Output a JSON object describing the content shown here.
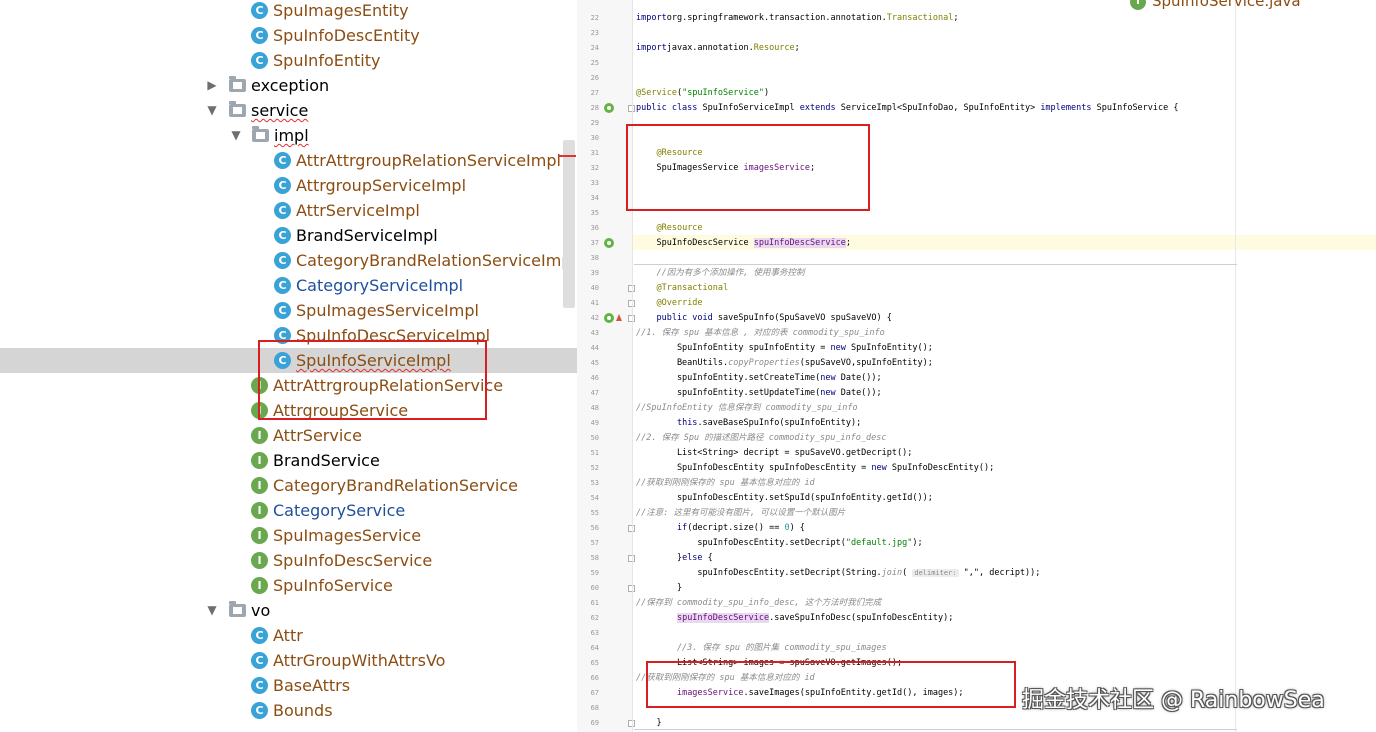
{
  "tree": {
    "rows": [
      {
        "label": "SpuImagesEntity",
        "icon": "class-icon",
        "style": "modified"
      },
      {
        "label": "SpuInfoDescEntity",
        "icon": "class-icon",
        "style": "modified"
      },
      {
        "label": "SpuInfoEntity",
        "icon": "class-icon",
        "style": "modified"
      },
      {
        "label": "exception",
        "icon": "folder-icon",
        "style": "normal",
        "arrow": "▶"
      },
      {
        "label": "service",
        "icon": "folder-icon",
        "style": "normal",
        "arrow": "▼"
      },
      {
        "label": "impl",
        "icon": "folder-icon",
        "style": "normal",
        "arrow": "▼"
      },
      {
        "label": "AttrAttrgroupRelationServiceImpl",
        "icon": "class-icon",
        "style": "modified"
      },
      {
        "label": "AttrgroupServiceImpl",
        "icon": "class-icon",
        "style": "modified"
      },
      {
        "label": "AttrServiceImpl",
        "icon": "class-icon",
        "style": "modified"
      },
      {
        "label": "BrandServiceImpl",
        "icon": "class-icon",
        "style": "normal"
      },
      {
        "label": "CategoryBrandRelationServiceImpl",
        "icon": "class-icon",
        "style": "modified"
      },
      {
        "label": "CategoryServiceImpl",
        "icon": "class-icon",
        "style": "blue"
      },
      {
        "label": "SpuImagesServiceImpl",
        "icon": "class-icon",
        "style": "modified"
      },
      {
        "label": "SpuInfoDescServiceImpl",
        "icon": "class-icon",
        "style": "modified"
      },
      {
        "label": "SpuInfoServiceImpl",
        "icon": "class-icon",
        "style": "modified",
        "selected": true
      },
      {
        "label": "AttrAttrgroupRelationService",
        "icon": "interface-icon",
        "style": "modified"
      },
      {
        "label": "AttrgroupService",
        "icon": "interface-icon",
        "style": "modified"
      },
      {
        "label": "AttrService",
        "icon": "interface-icon",
        "style": "modified"
      },
      {
        "label": "BrandService",
        "icon": "interface-icon",
        "style": "normal"
      },
      {
        "label": "CategoryBrandRelationService",
        "icon": "interface-icon",
        "style": "modified"
      },
      {
        "label": "CategoryService",
        "icon": "interface-icon",
        "style": "blue"
      },
      {
        "label": "SpuImagesService",
        "icon": "interface-icon",
        "style": "modified"
      },
      {
        "label": "SpuInfoDescService",
        "icon": "interface-icon",
        "style": "modified"
      },
      {
        "label": "SpuInfoService",
        "icon": "interface-icon",
        "style": "modified"
      },
      {
        "label": "vo",
        "icon": "folder-icon",
        "style": "normal",
        "arrow": "▼"
      },
      {
        "label": "Attr",
        "icon": "class-icon",
        "style": "modified"
      },
      {
        "label": "AttrGroupWithAttrsVo",
        "icon": "class-icon",
        "style": "modified"
      },
      {
        "label": "BaseAttrs",
        "icon": "class-icon",
        "style": "modified"
      },
      {
        "label": "Bounds",
        "icon": "class-icon",
        "style": "modified"
      }
    ]
  },
  "editor": {
    "tab_title": "SpuInfoService.java",
    "lines": [
      {
        "n": "22",
        "tokens": [
          [
            "kw",
            "import"
          ],
          [
            "",
            "org.springframework.transaction.annotation."
          ],
          [
            "an",
            "Transactional"
          ],
          [
            "",
            ";"
          ]
        ]
      },
      {
        "n": "23",
        "tokens": []
      },
      {
        "n": "24",
        "tokens": [
          [
            "kw",
            "import"
          ],
          [
            "",
            "javax.annotation."
          ],
          [
            "an",
            "Resource"
          ],
          [
            "",
            ";"
          ]
        ]
      },
      {
        "n": "25",
        "tokens": []
      },
      {
        "n": "26",
        "tokens": []
      },
      {
        "n": "27",
        "tokens": [
          [
            "an",
            "@Service"
          ],
          [
            "",
            "("
          ],
          [
            "st",
            "\"spuInfoService\""
          ],
          [
            "",
            ")"
          ]
        ]
      },
      {
        "n": "28",
        "tokens": [
          [
            "kw",
            "public class"
          ],
          [
            "",
            " SpuInfoServiceImpl "
          ],
          [
            "kw",
            "extends"
          ],
          [
            "",
            " ServiceImpl<SpuInfoDao, SpuInfoEntity> "
          ],
          [
            "kw",
            "implements"
          ],
          [
            "",
            " SpuInfoService {"
          ]
        ]
      },
      {
        "n": "29",
        "tokens": []
      },
      {
        "n": "30",
        "tokens": []
      },
      {
        "n": "31",
        "tokens": [
          [
            "",
            "    "
          ],
          [
            "an",
            "@Resource"
          ]
        ]
      },
      {
        "n": "32",
        "tokens": [
          [
            "",
            "    SpuImagesService "
          ],
          [
            "fd",
            "imagesService"
          ],
          [
            "",
            ";"
          ]
        ]
      },
      {
        "n": "33",
        "tokens": []
      },
      {
        "n": "34",
        "tokens": []
      },
      {
        "n": "35",
        "tokens": []
      },
      {
        "n": "36",
        "tokens": [
          [
            "",
            "    "
          ],
          [
            "an",
            "@Resource"
          ]
        ]
      },
      {
        "n": "37",
        "tokens": [
          [
            "",
            "    SpuInfoDescService "
          ],
          [
            "fd hl",
            "spuInfoDescService"
          ],
          [
            "",
            ";"
          ]
        ]
      },
      {
        "n": "38",
        "tokens": []
      },
      {
        "n": "39",
        "tokens": [
          [
            "cm",
            "    //因为有多个添加操作, 使用事务控制"
          ]
        ]
      },
      {
        "n": "40",
        "tokens": [
          [
            "",
            "    "
          ],
          [
            "an",
            "@Transactional"
          ]
        ]
      },
      {
        "n": "41",
        "tokens": [
          [
            "",
            "    "
          ],
          [
            "an",
            "@Override"
          ]
        ]
      },
      {
        "n": "42",
        "tokens": [
          [
            "",
            "    "
          ],
          [
            "kw",
            "public void"
          ],
          [
            "",
            " saveSpuInfo(SpuSaveVO spuSaveVO) {"
          ]
        ]
      },
      {
        "n": "43",
        "tokens": [
          [
            "cm",
            "//1. 保存 spu 基本信息 , 对应的表 commodity_spu_info"
          ]
        ]
      },
      {
        "n": "44",
        "tokens": [
          [
            "",
            "        SpuInfoEntity spuInfoEntity = "
          ],
          [
            "kw",
            "new"
          ],
          [
            "",
            " SpuInfoEntity();"
          ]
        ]
      },
      {
        "n": "45",
        "tokens": [
          [
            "",
            "        BeanUtils."
          ],
          [
            "cm",
            "copyProperties"
          ],
          [
            "",
            "(spuSaveVO,spuInfoEntity);"
          ]
        ]
      },
      {
        "n": "46",
        "tokens": [
          [
            "",
            "        spuInfoEntity.setCreateTime("
          ],
          [
            "kw",
            "new"
          ],
          [
            "",
            " Date());"
          ]
        ]
      },
      {
        "n": "47",
        "tokens": [
          [
            "",
            "        spuInfoEntity.setUpdateTime("
          ],
          [
            "kw",
            "new"
          ],
          [
            "",
            " Date());"
          ]
        ]
      },
      {
        "n": "48",
        "tokens": [
          [
            "cm",
            "//SpuInfoEntity 信息保存到 commodity_spu_info"
          ]
        ]
      },
      {
        "n": "49",
        "tokens": [
          [
            "",
            "        "
          ],
          [
            "kw",
            "this"
          ],
          [
            "",
            ".saveBaseSpuInfo(spuInfoEntity);"
          ]
        ]
      },
      {
        "n": "50",
        "tokens": [
          [
            "cm",
            "//2. 保存 Spu 的描述图片路径 commodity_spu_info_desc"
          ]
        ]
      },
      {
        "n": "51",
        "tokens": [
          [
            "",
            "        List<String> "
          ],
          [
            "",
            "decript"
          ],
          [
            "",
            " = spuSaveVO.getDecript();"
          ]
        ]
      },
      {
        "n": "52",
        "tokens": [
          [
            "",
            "        SpuInfoDescEntity spuInfoDescEntity = "
          ],
          [
            "kw",
            "new"
          ],
          [
            "",
            " SpuInfoDescEntity();"
          ]
        ]
      },
      {
        "n": "53",
        "tokens": [
          [
            "cm",
            "//获取到刚刚保存的 spu 基本信息对应的 id"
          ]
        ]
      },
      {
        "n": "54",
        "tokens": [
          [
            "",
            "        spuInfoDescEntity.setSpuId(spuInfoEntity.getId());"
          ]
        ]
      },
      {
        "n": "55",
        "tokens": [
          [
            "cm",
            "//注意: 这里有可能没有图片, 可以设置一个默认图片"
          ]
        ]
      },
      {
        "n": "56",
        "tokens": [
          [
            "",
            "        "
          ],
          [
            "kw",
            "if"
          ],
          [
            "",
            "(decript.size() == "
          ],
          [
            "ty",
            "0"
          ],
          [
            "",
            ") {"
          ]
        ]
      },
      {
        "n": "57",
        "tokens": [
          [
            "",
            "            spuInfoDescEntity.setDecript("
          ],
          [
            "st",
            "\"default.jpg\""
          ],
          [
            "",
            ");"
          ]
        ]
      },
      {
        "n": "58",
        "tokens": [
          [
            "",
            "        }"
          ],
          [
            "kw",
            "else"
          ],
          [
            "",
            " {"
          ]
        ]
      },
      {
        "n": "59",
        "tokens": [
          [
            "",
            "            spuInfoDescEntity.setDecript(String."
          ],
          [
            "cm",
            "join"
          ],
          [
            "",
            "( "
          ],
          [
            "hint",
            "delimiter:"
          ],
          [
            "",
            " \",\", decript));"
          ]
        ]
      },
      {
        "n": "60",
        "tokens": [
          [
            "",
            "        }"
          ]
        ]
      },
      {
        "n": "61",
        "tokens": [
          [
            "cm",
            "//保存到 commodity_spu_info_desc, 这个方法时我们完成"
          ]
        ]
      },
      {
        "n": "62",
        "tokens": [
          [
            "",
            "        "
          ],
          [
            "fd hl",
            "spuInfoDescService"
          ],
          [
            "",
            ".saveSpuInfoDesc(spuInfoDescEntity);"
          ]
        ]
      },
      {
        "n": "63",
        "tokens": []
      },
      {
        "n": "64",
        "tokens": [
          [
            "cm",
            "        //3. 保存 spu 的图片集 commodity_spu_images"
          ]
        ]
      },
      {
        "n": "65",
        "tokens": [
          [
            "",
            "        List<String> images = spuSaveVO.getImages();"
          ]
        ]
      },
      {
        "n": "66",
        "tokens": [
          [
            "cm",
            "//获取到刚刚保存的 spu 基本信息对应的 id"
          ]
        ]
      },
      {
        "n": "67",
        "tokens": [
          [
            "",
            "        "
          ],
          [
            "fd",
            "imagesService"
          ],
          [
            "",
            ".saveImages(spuInfoEntity.getId(), images);"
          ]
        ]
      },
      {
        "n": "68",
        "tokens": []
      },
      {
        "n": "69",
        "tokens": [
          [
            "",
            "    }"
          ]
        ]
      }
    ]
  },
  "watermark": "掘金技术社区 @ RainbowSea"
}
